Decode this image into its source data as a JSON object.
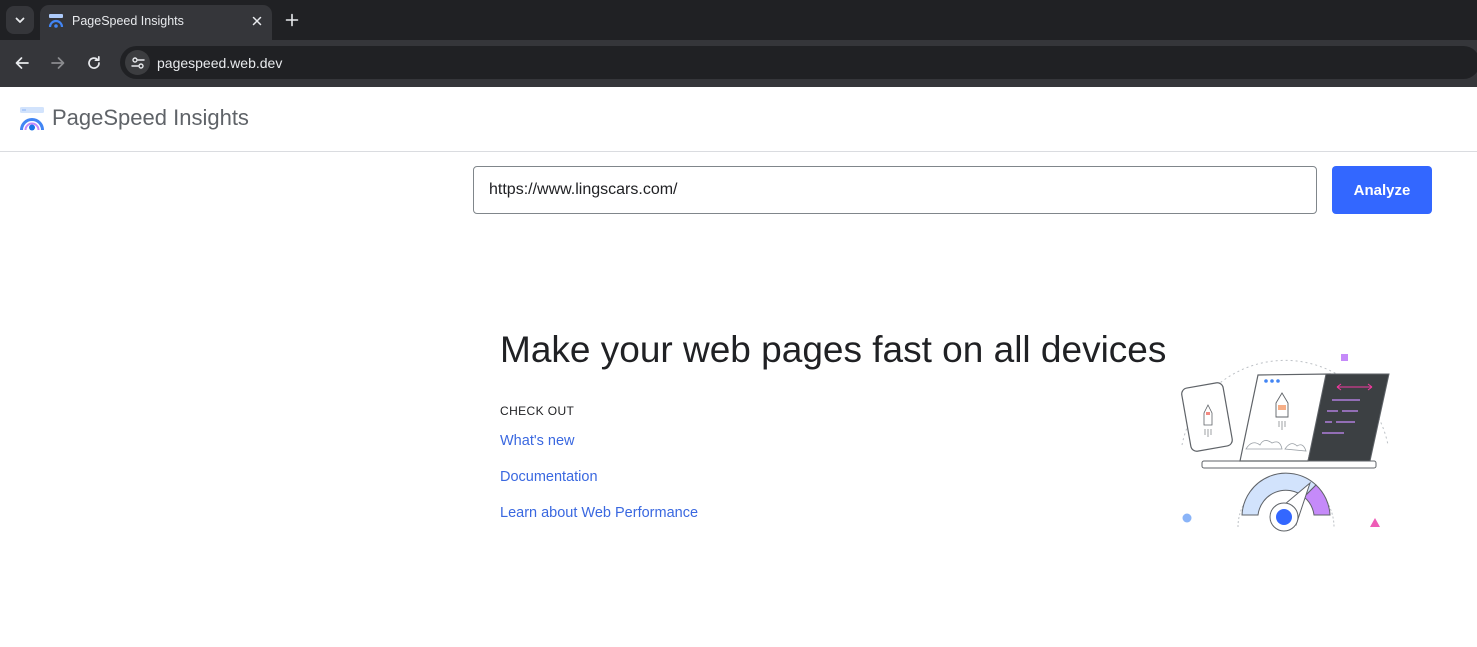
{
  "browser": {
    "tab": {
      "title": "PageSpeed Insights",
      "favicon": "pagespeed-favicon"
    },
    "address_bar": {
      "url": "pagespeed.web.dev"
    },
    "icons": {
      "tab_search": "chevron-down-icon",
      "tab_close": "close-icon",
      "new_tab": "plus-icon",
      "back": "back-arrow-icon",
      "forward": "forward-arrow-icon",
      "reload": "reload-icon",
      "site_info": "tune-icon"
    }
  },
  "header": {
    "title": "PageSpeed Insights"
  },
  "search": {
    "value": "https://www.lingscars.com/",
    "button_label": "Analyze"
  },
  "main": {
    "headline": "Make your web pages fast on all devices",
    "checkout_label": "CHECK OUT",
    "links": [
      "What's new",
      "Documentation",
      "Learn about Web Performance"
    ]
  },
  "colors": {
    "accent": "#3367ff",
    "link": "#3a68e0",
    "chrome_dark": "#202124",
    "chrome_toolbar": "#35363a"
  }
}
